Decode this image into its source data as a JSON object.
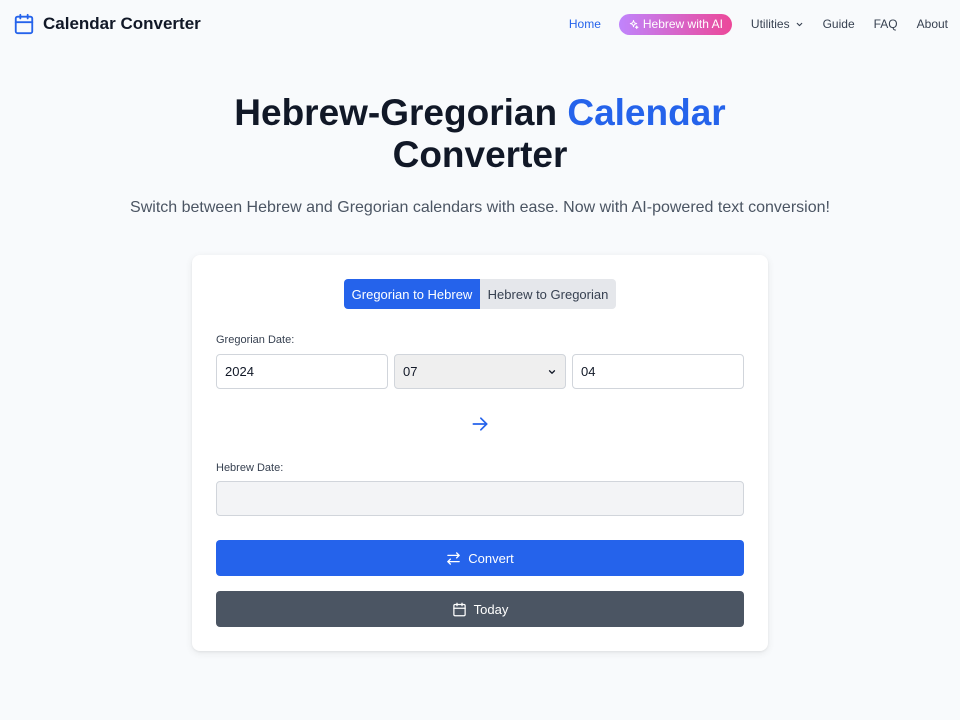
{
  "header": {
    "brand": "Calendar Converter",
    "brand_icon": "calendar-icon",
    "nav": {
      "home": "Home",
      "ai": "Hebrew with AI",
      "utilities": "Utilities",
      "guide": "Guide",
      "faq": "FAQ",
      "about": "About"
    }
  },
  "hero": {
    "title_part1": "Hebrew-Gregorian",
    "title_accent": "Calendar",
    "title_part2": "Converter",
    "subtitle": "Switch between Hebrew and Gregorian calendars with ease. Now with AI-powered text conversion!"
  },
  "converter": {
    "tabs": [
      "Gregorian to Hebrew",
      "Hebrew to Gregorian"
    ],
    "active_tab": "Gregorian to Hebrew",
    "gregorian_label": "Gregorian Date:",
    "year": "2024",
    "month": "07",
    "day": "04",
    "hebrew_label": "Hebrew Date:",
    "hebrew_value": "",
    "convert_label": "Convert",
    "today_label": "Today"
  },
  "colors": {
    "accent": "#2563eb",
    "ai_gradient_start": "#c084fc",
    "ai_gradient_end": "#ec4899",
    "today_button": "#4b5563"
  }
}
